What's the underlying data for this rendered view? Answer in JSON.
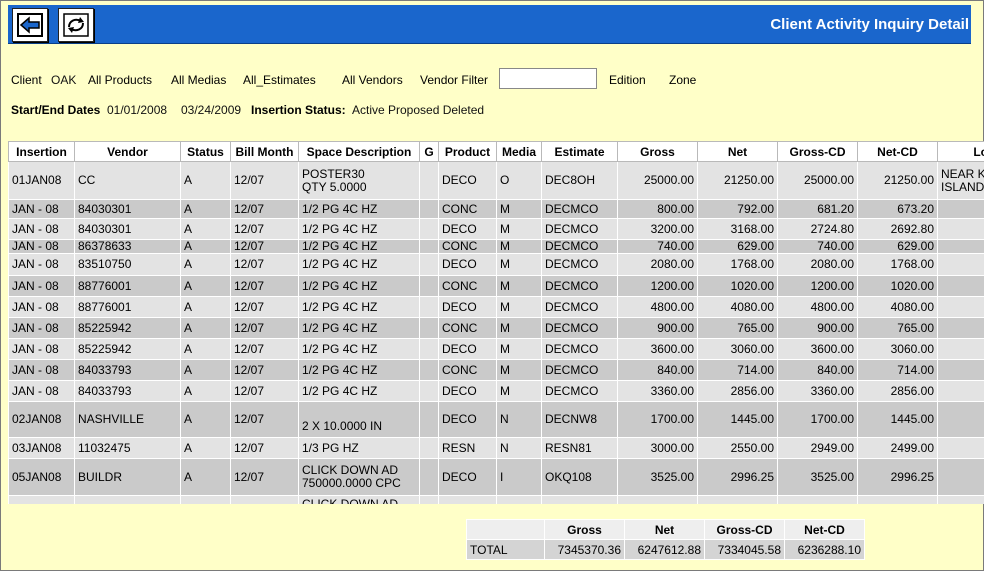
{
  "header": {
    "title": "Client Activity Inquiry Detail"
  },
  "filters": {
    "client_label": "Client",
    "client_value": "OAK",
    "products": "All Products",
    "medias": "All Medias",
    "estimates": "All_Estimates",
    "vendors": "All Vendors",
    "vendor_filter_label": "Vendor Filter",
    "vendor_filter_value": "",
    "edition_label": "Edition",
    "zone_label": "Zone",
    "dates_label": "Start/End Dates",
    "start_date": "01/01/2008",
    "end_date": "03/24/2009",
    "status_label": "Insertion Status:",
    "status_value": "Active Proposed Deleted"
  },
  "grid": {
    "columns": [
      "Insertion",
      "Vendor",
      "Status",
      "Bill Month",
      "Space Description",
      "G",
      "Product",
      "Media",
      "Estimate",
      "Gross",
      "Net",
      "Gross-CD",
      "Net-CD",
      "Loc"
    ],
    "rows": [
      [
        "01JAN08",
        "CC",
        "A",
        "12/07",
        "POSTER30\nQTY 5.0000",
        "",
        "DECO",
        "O",
        "DEC8OH",
        "25000.00",
        "21250.00",
        "25000.00",
        "21250.00",
        "NEAR K\nISLAND"
      ],
      [
        "JAN - 08",
        "84030301",
        "A",
        "12/07",
        "1/2 PG 4C HZ",
        "",
        "CONC",
        "M",
        "DECMCO",
        "800.00",
        "792.00",
        "681.20",
        "673.20",
        ""
      ],
      [
        "JAN - 08",
        "84030301",
        "A",
        "12/07",
        "1/2 PG 4C HZ",
        "",
        "DECO",
        "M",
        "DECMCO",
        "3200.00",
        "3168.00",
        "2724.80",
        "2692.80",
        ""
      ],
      [
        "JAN - 08",
        "86378633",
        "A",
        "12/07",
        "1/2 PG 4C HZ",
        "",
        "CONC",
        "M",
        "DECMCO",
        "740.00",
        "629.00",
        "740.00",
        "629.00",
        ""
      ],
      [
        "JAN - 08",
        "83510750",
        "A",
        "12/07",
        "1/2 PG 4C HZ",
        "",
        "DECO",
        "M",
        "DECMCO",
        "2080.00",
        "1768.00",
        "2080.00",
        "1768.00",
        ""
      ],
      [
        "JAN - 08",
        "88776001",
        "A",
        "12/07",
        "1/2 PG 4C HZ",
        "",
        "CONC",
        "M",
        "DECMCO",
        "1200.00",
        "1020.00",
        "1200.00",
        "1020.00",
        ""
      ],
      [
        "JAN - 08",
        "88776001",
        "A",
        "12/07",
        "1/2 PG 4C HZ",
        "",
        "DECO",
        "M",
        "DECMCO",
        "4800.00",
        "4080.00",
        "4800.00",
        "4080.00",
        ""
      ],
      [
        "JAN - 08",
        "85225942",
        "A",
        "12/07",
        "1/2 PG 4C HZ",
        "",
        "CONC",
        "M",
        "DECMCO",
        "900.00",
        "765.00",
        "900.00",
        "765.00",
        ""
      ],
      [
        "JAN - 08",
        "85225942",
        "A",
        "12/07",
        "1/2 PG 4C HZ",
        "",
        "DECO",
        "M",
        "DECMCO",
        "3600.00",
        "3060.00",
        "3600.00",
        "3060.00",
        ""
      ],
      [
        "JAN - 08",
        "84033793",
        "A",
        "12/07",
        "1/2 PG 4C HZ",
        "",
        "CONC",
        "M",
        "DECMCO",
        "840.00",
        "714.00",
        "840.00",
        "714.00",
        ""
      ],
      [
        "JAN - 08",
        "84033793",
        "A",
        "12/07",
        "1/2 PG 4C HZ",
        "",
        "DECO",
        "M",
        "DECMCO",
        "3360.00",
        "2856.00",
        "3360.00",
        "2856.00",
        ""
      ],
      [
        "02JAN08",
        "NASHVILLE",
        "A",
        "12/07",
        "\n2 X 10.0000 IN",
        "",
        "DECO",
        "N",
        "DECNW8",
        "1700.00",
        "1445.00",
        "1700.00",
        "1445.00",
        ""
      ],
      [
        "03JAN08",
        "11032475",
        "A",
        "12/07",
        "1/3 PG HZ",
        "",
        "RESN",
        "N",
        "RESN81",
        "3000.00",
        "2550.00",
        "2949.00",
        "2499.00",
        ""
      ],
      [
        "05JAN08",
        "BUILDR",
        "A",
        "12/07",
        "CLICK DOWN AD\n750000.0000 CPC",
        "",
        "DECO",
        "I",
        "OKQ108",
        "3525.00",
        "2996.25",
        "3525.00",
        "2996.25",
        ""
      ],
      [
        "",
        "",
        "",
        "",
        "CLICK DOWN AD",
        "",
        "",
        "",
        "",
        "",
        "",
        "",
        "",
        ""
      ]
    ]
  },
  "totals": {
    "columns": [
      "Gross",
      "Net",
      "Gross-CD",
      "Net-CD"
    ],
    "label": "TOTAL",
    "values": [
      "7345370.36",
      "6247612.88",
      "7334045.58",
      "6236288.10"
    ]
  }
}
